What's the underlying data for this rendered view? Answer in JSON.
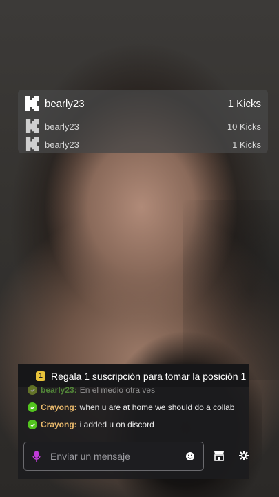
{
  "leaderboard": {
    "entries": [
      {
        "name": "bearly23",
        "value": "1 Kicks"
      },
      {
        "name": "bearly23",
        "value": "10 Kicks"
      },
      {
        "name": "bearly23",
        "value": "1 Kicks"
      }
    ]
  },
  "chat": {
    "pinned": {
      "rank": "1",
      "text": "Regala 1 suscripción para tomar la posición 1"
    },
    "messages": [
      {
        "user": "bearly23:",
        "text": "En el medio otra ves"
      },
      {
        "user": "Crayong:",
        "text": "when u are at home we should do a collab"
      },
      {
        "user": "Crayong:",
        "text": "i added u on discord"
      }
    ],
    "input_placeholder": "Enviar un mensaje"
  },
  "colors": {
    "accent": "#53c41f",
    "pin_badge": "#e8c33a",
    "username": "#e8b86b"
  },
  "icons": [
    "kick-logo-icon",
    "verified-check-icon",
    "microphone-icon",
    "emoji-icon",
    "store-icon",
    "settings-icon"
  ]
}
